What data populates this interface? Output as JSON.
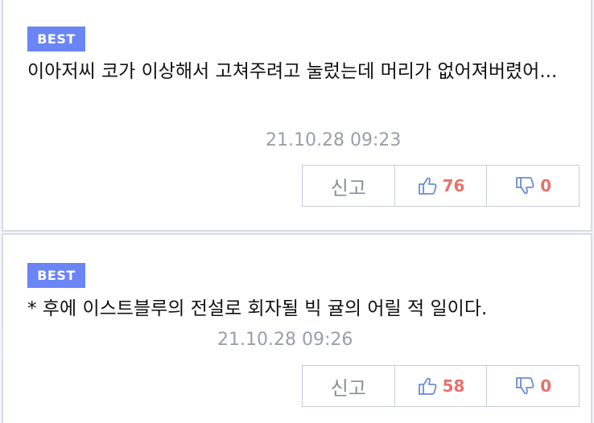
{
  "comments": [
    {
      "badge": "BEST",
      "text": "이아저씨 코가 이상해서 고쳐주려고 눌렀는데 머리가 없어져버렸어...",
      "meta_visible": "21.10.28 09:23",
      "report_label": "신고",
      "likes": "76",
      "dislikes": "0"
    },
    {
      "badge": "BEST",
      "text": "* 후에 이스트블루의 전설로 회자될 빅 귤의 어릴 적 일이다.",
      "meta_visible": "21.10.28 09:26",
      "report_label": "신고",
      "likes": "58",
      "dislikes": "0"
    }
  ],
  "colors": {
    "badge": "#6a85f5",
    "count": "#e9706a",
    "icon": "#6b8bd6"
  },
  "icons": {
    "like": "thumbs-up-icon",
    "dislike": "thumbs-down-icon"
  }
}
